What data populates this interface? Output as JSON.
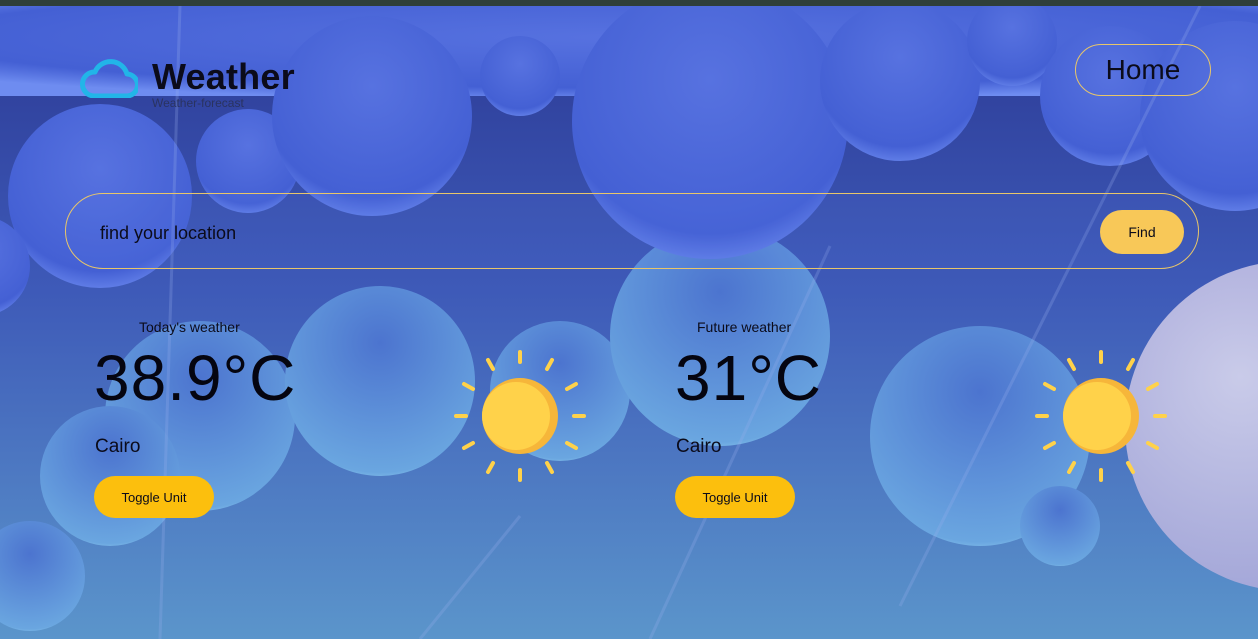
{
  "brand": {
    "title": "Weather",
    "subtitle": "Weather-forecast",
    "icon": "cloud-icon"
  },
  "nav": {
    "home_label": "Home"
  },
  "search": {
    "placeholder": "find your location",
    "value": "",
    "find_label": "Find",
    "icon": "none"
  },
  "today": {
    "label": "Today's weather",
    "temperature": "38.9°C",
    "city": "Cairo",
    "toggle_label": "Toggle Unit",
    "icon": "sun-icon"
  },
  "future": {
    "label": "Future weather",
    "temperature": "31°C",
    "city": "Cairo",
    "toggle_label": "Toggle Unit",
    "icon": "sun-icon"
  },
  "colors": {
    "accent_yellow": "#fcbf0d",
    "find_button": "#f8c858",
    "border_gold": "#e8c66a",
    "sky_top": "#2a3a96",
    "sky_bottom": "#5a94cc",
    "cloud": "#4a64d8",
    "sun": "#ffd24a"
  }
}
